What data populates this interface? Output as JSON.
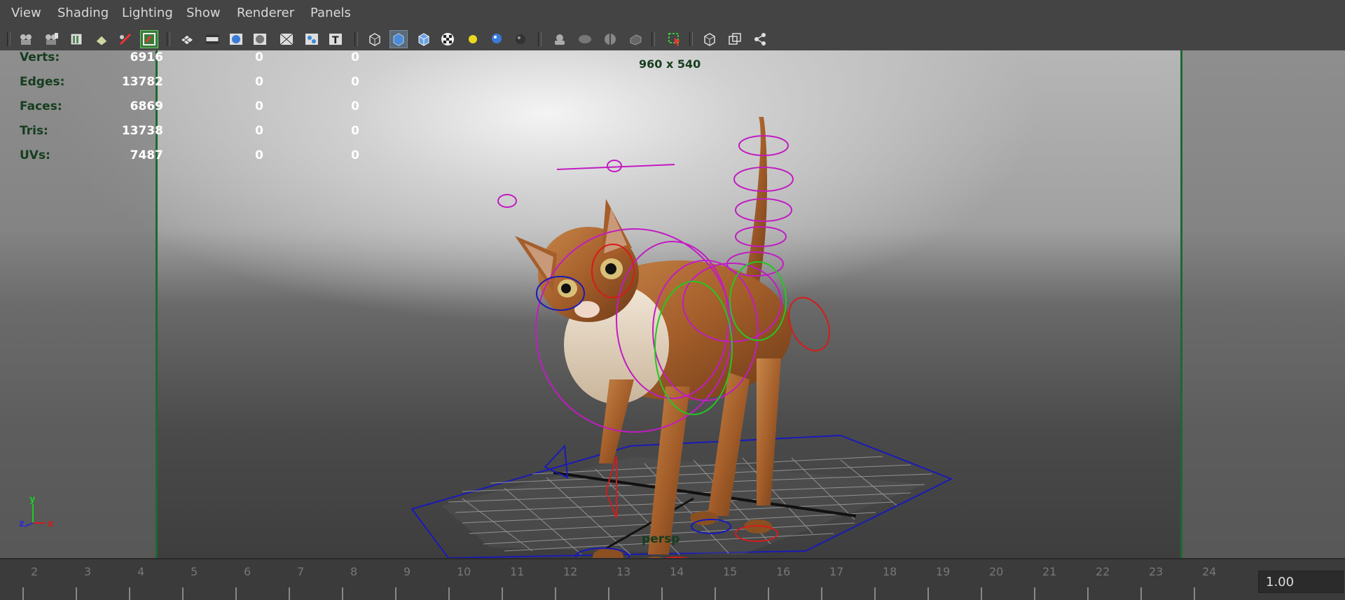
{
  "menu": [
    "View",
    "Shading",
    "Lighting",
    "Show",
    "Renderer",
    "Panels"
  ],
  "toolbar_icons": [
    "camera-attributes-icon",
    "camera-bookmarks-icon",
    "image-plane-icon",
    "two-d-pan-zoom-icon",
    "grease-pencil-icon",
    "isolate-select-icon",
    "grid-toggle-icon",
    "film-gate-icon",
    "resolution-gate-icon",
    "gate-mask-icon",
    "field-chart-icon",
    "safe-action-icon",
    "safe-title-icon",
    "wireframe-icon",
    "smooth-shade-icon",
    "wireframe-on-shaded-icon",
    "textured-icon",
    "use-all-lights-icon",
    "shadows-icon",
    "ambient-occlusion-icon",
    "xray-icon",
    "xray-joints-icon",
    "backface-culling-icon",
    "smooth-wireframe-icon",
    "select-camera-icon",
    "isolate-view-icon",
    "frame-selected-icon",
    "node-editor-icon"
  ],
  "hud": {
    "rows": [
      {
        "label": "Verts:",
        "values": [
          "6916",
          "0",
          "0"
        ]
      },
      {
        "label": "Edges:",
        "values": [
          "13782",
          "0",
          "0"
        ]
      },
      {
        "label": "Faces:",
        "values": [
          "6869",
          "0",
          "0"
        ]
      },
      {
        "label": "Tris:",
        "values": [
          "13738",
          "0",
          "0"
        ]
      },
      {
        "label": "UVs:",
        "values": [
          "7487",
          "0",
          "0"
        ]
      }
    ]
  },
  "resolution_label": "960 x 540",
  "camera_label": "persp",
  "axis": {
    "x": "x",
    "y": "y",
    "z": "z"
  },
  "timeline": {
    "frames": [
      "2",
      "3",
      "4",
      "5",
      "6",
      "7",
      "8",
      "9",
      "10",
      "11",
      "12",
      "13",
      "14",
      "15",
      "16",
      "17",
      "18",
      "19",
      "20",
      "21",
      "22",
      "23",
      "24"
    ],
    "current_time": "1.00"
  },
  "colors": {
    "gate_line": "#1b6a30",
    "hud_label": "#153d1e",
    "control_magenta": "#c21cc2",
    "control_red": "#d41c1c",
    "control_green": "#22c822",
    "control_blue": "#1a1ab8"
  }
}
